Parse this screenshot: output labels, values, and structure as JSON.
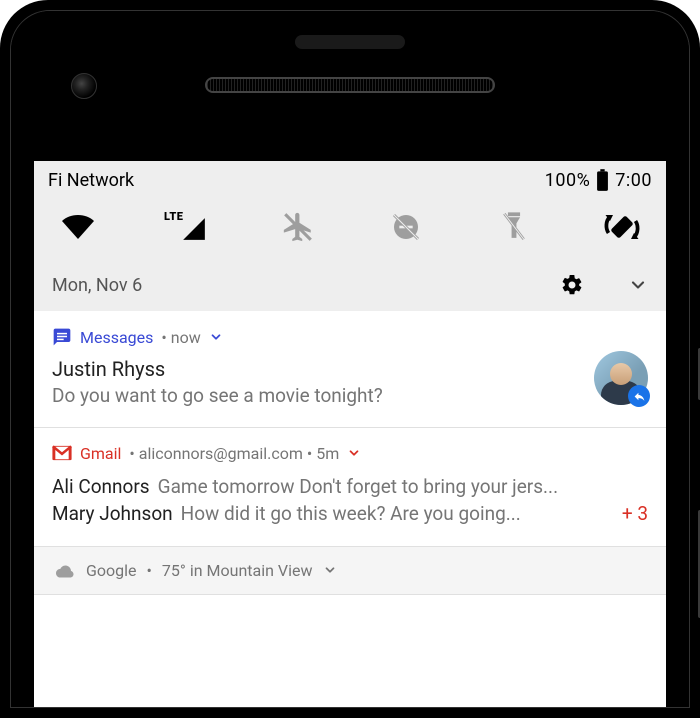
{
  "status": {
    "carrier": "Fi Network",
    "battery_pct": "100%",
    "time": "7:00"
  },
  "qs": {
    "date": "Mon, Nov 6",
    "cellular_label": "LTE",
    "icons": {
      "wifi": "wifi",
      "cellular": "cellular-lte",
      "airplane": "airplane-off",
      "dnd": "dnd-off",
      "flashlight": "flashlight-off",
      "rotate": "auto-rotate"
    }
  },
  "notifications": [
    {
      "app": "Messages",
      "meta": "now",
      "title": "Justin Rhyss",
      "text": "Do you want to go see a movie tonight?",
      "accent": "#3949d5"
    },
    {
      "app": "Gmail",
      "meta": "aliconnors@gmail.com • 5m",
      "accent": "#d93025",
      "emails": [
        {
          "sender": "Ali Connors",
          "preview": "Game tomorrow Don't forget to bring your jers..."
        },
        {
          "sender": "Mary Johnson",
          "preview": "How did it go this week? Are you going..."
        }
      ],
      "extra_count": "+ 3"
    }
  ],
  "weather": {
    "service": "Google",
    "summary": "75° in Mountain View"
  }
}
